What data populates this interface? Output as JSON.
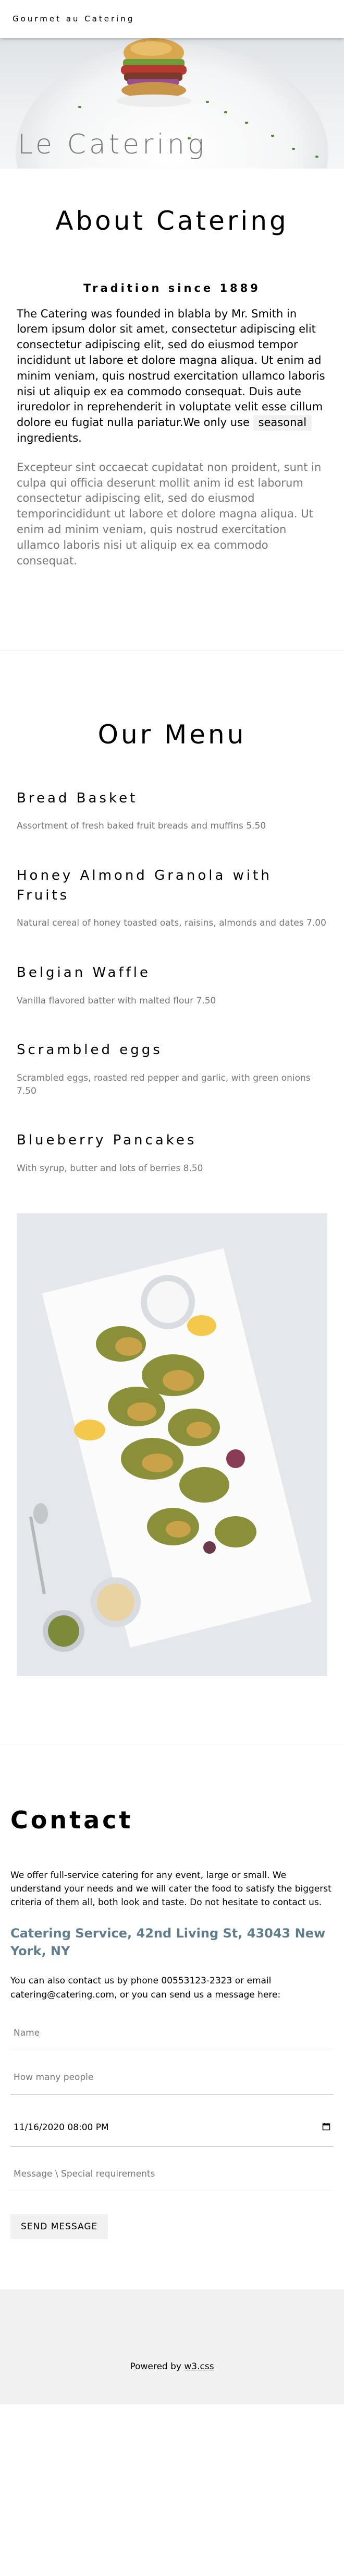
{
  "topbar": {
    "brand": "Gourmet au Catering"
  },
  "hero": {
    "title": "Le Catering"
  },
  "about": {
    "title": "About Catering",
    "subtitle": "Tradition since 1889",
    "p1_before": "The Catering was founded in blabla by Mr. Smith in lorem ipsum dolor sit amet, consectetur adipiscing elit consectetur adipiscing elit, sed do eiusmod tempor incididunt ut labore et dolore magna aliqua. Ut enim ad minim veniam, quis nostrud exercitation ullamco laboris nisi ut aliquip ex ea commodo consequat. Duis aute iruredolor in reprehenderit in voluptate velit esse cillum dolore eu fugiat nulla pariatur.We only use",
    "p1_tag": "seasonal",
    "p1_after": "ingredients.",
    "p2": "Excepteur sint occaecat cupidatat non proident, sunt in culpa qui officia deserunt mollit anim id est laborum consectetur adipiscing elit, sed do eiusmod temporincididunt ut labore et dolore magna aliqua. Ut enim ad minim veniam, quis nostrud exercitation ullamco laboris nisi ut aliquip ex ea commodo consequat."
  },
  "menu": {
    "title": "Our Menu",
    "items": [
      {
        "name": "Bread Basket",
        "desc": "Assortment of fresh baked fruit breads and muffins 5.50"
      },
      {
        "name": "Honey Almond Granola with Fruits",
        "desc": "Natural cereal of honey toasted oats, raisins, almonds and dates 7.00"
      },
      {
        "name": "Belgian Waffle",
        "desc": "Vanilla flavored batter with malted flour 7.50"
      },
      {
        "name": "Scrambled eggs",
        "desc": "Scrambled eggs, roasted red pepper and garlic, with green onions 7.50"
      },
      {
        "name": "Blueberry Pancakes",
        "desc": "With syrup, butter and lots of berries 8.50"
      }
    ]
  },
  "contact": {
    "title": "Contact",
    "intro": "We offer full-service catering for any event, large or small. We understand your needs and we will cater the food to satisfy the biggerst criteria of them all, both look and taste. Do not hesitate to contact us.",
    "address": "Catering Service, 42nd Living St, 43043 New York, NY",
    "note": "You can also contact us by phone 00553123-2323 or email catering@catering.com, or you can send us a message here:",
    "name_placeholder": "Name",
    "people_placeholder": "How many people",
    "datetime_value": "11/16/2020 08:00 PM",
    "message_placeholder": "Message \\ Special requirements",
    "send_label": "SEND MESSAGE"
  },
  "footer": {
    "prefix": "Powered by",
    "link": "w3.css"
  }
}
